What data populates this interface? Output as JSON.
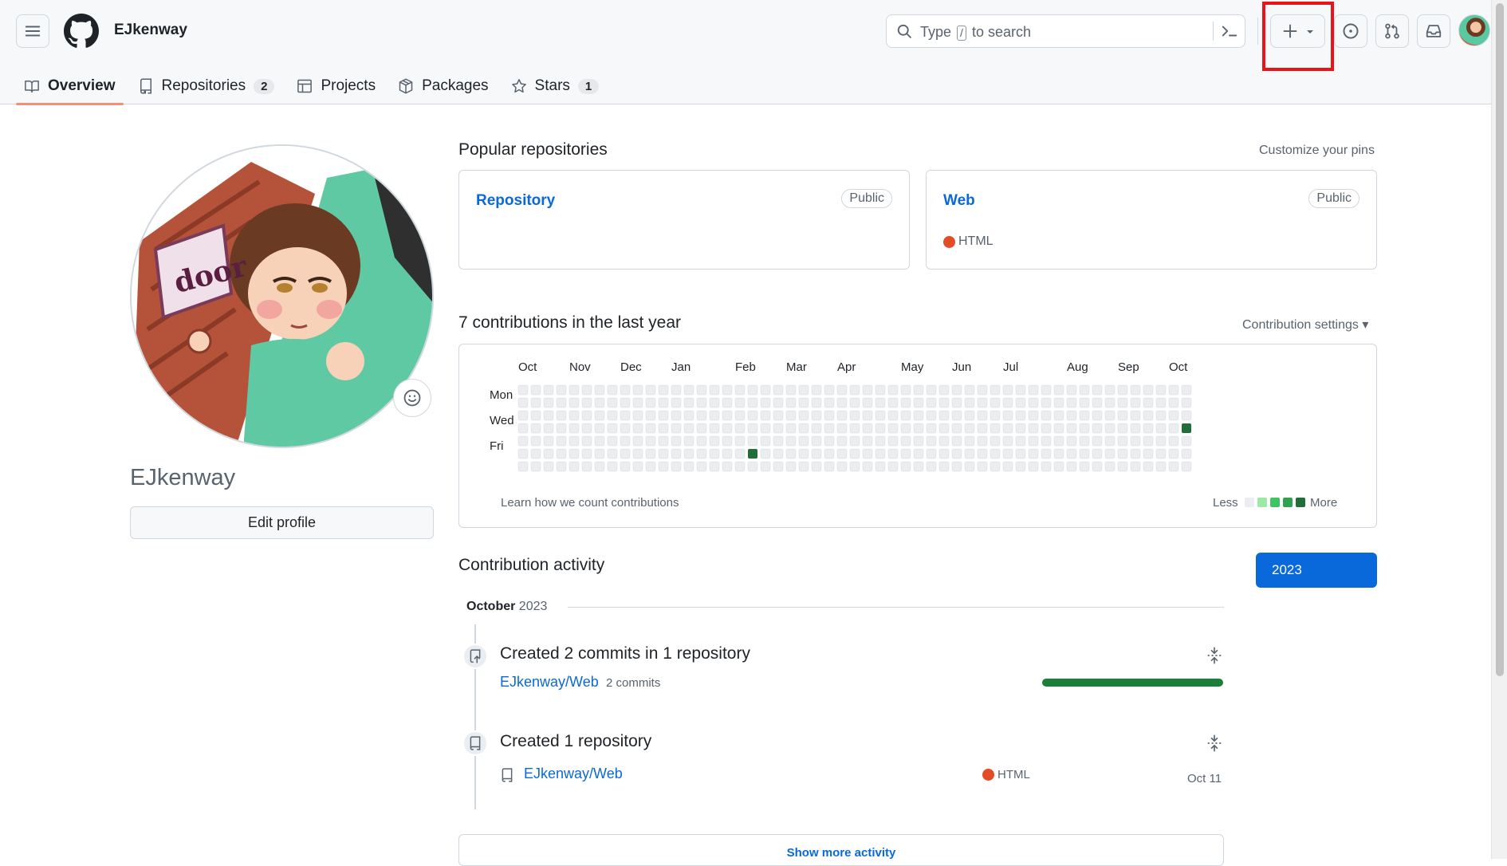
{
  "header": {
    "username": "EJkenway",
    "search": {
      "prefix": "Type",
      "slash": "/",
      "suffix": "to search"
    }
  },
  "tabs": [
    {
      "label": "Overview",
      "count": null,
      "active": true
    },
    {
      "label": "Repositories",
      "count": "2"
    },
    {
      "label": "Projects",
      "count": null
    },
    {
      "label": "Packages",
      "count": null
    },
    {
      "label": "Stars",
      "count": "1"
    }
  ],
  "profile": {
    "name": "EJkenway",
    "edit_label": "Edit profile",
    "avatar_sign_text": "door"
  },
  "popular": {
    "title": "Popular repositories",
    "customize": "Customize your pins",
    "repos": [
      {
        "name": "Repository",
        "visibility": "Public",
        "language": ""
      },
      {
        "name": "Web",
        "visibility": "Public",
        "language": "HTML"
      }
    ]
  },
  "contributions": {
    "title": "7 contributions in the last year",
    "settings": "Contribution settings",
    "months": [
      "Oct",
      "Nov",
      "Dec",
      "Jan",
      "Feb",
      "Mar",
      "Apr",
      "May",
      "Jun",
      "Jul",
      "Aug",
      "Sep",
      "Oct"
    ],
    "days": [
      "Mon",
      "Wed",
      "Fri"
    ],
    "learn": "Learn how we count contributions",
    "less": "Less",
    "more": "More",
    "weeks": 53,
    "active_cells": [
      {
        "week": 18,
        "day": 5,
        "level": 4
      },
      {
        "week": 52,
        "day": 3,
        "level": 4
      }
    ],
    "colors": {
      "empty": "#ebedf0",
      "l1": "#9be9a8",
      "l2": "#40c463",
      "l3": "#30a14e",
      "l4": "#216e39"
    }
  },
  "activity": {
    "title": "Contribution activity",
    "year": "2023",
    "month": "October",
    "month_year": "2023",
    "items": [
      {
        "title": "Created 2 commits in 1 repository",
        "repo": "EJkenway/Web",
        "meta": "2 commits",
        "progress": 1.0
      },
      {
        "title": "Created 1 repository",
        "repo": "EJkenway/Web",
        "language": "HTML",
        "date": "Oct 11"
      }
    ],
    "show_more": "Show more activity"
  }
}
